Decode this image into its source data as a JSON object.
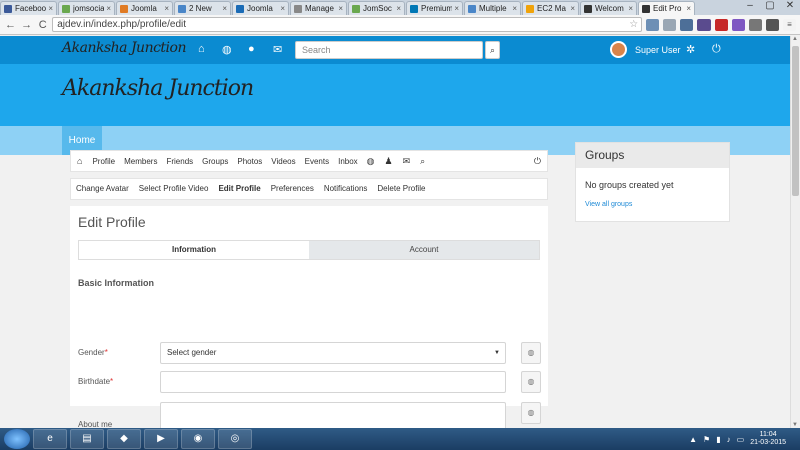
{
  "browser": {
    "tabs": [
      {
        "label": "Facebook",
        "color": "#3b5998",
        "active": false
      },
      {
        "label": "jomsocial",
        "color": "#6aa84f",
        "active": false
      },
      {
        "label": "Joomla",
        "color": "#e07b24",
        "active": false
      },
      {
        "label": "2 New",
        "color": "#4a86c8",
        "active": false
      },
      {
        "label": "Joomla",
        "color": "#1a6bb6",
        "active": false
      },
      {
        "label": "Manage",
        "color": "#888888",
        "active": false
      },
      {
        "label": "JomSoc",
        "color": "#6aa84f",
        "active": false
      },
      {
        "label": "Premium",
        "color": "#0077b5",
        "active": false
      },
      {
        "label": "Multiple",
        "color": "#4a86c8",
        "active": false
      },
      {
        "label": "EC2 Ma",
        "color": "#f0a30a",
        "active": false
      },
      {
        "label": "Welcom",
        "color": "#333333",
        "active": false
      },
      {
        "label": "Edit Pro",
        "color": "#333333",
        "active": true
      }
    ],
    "tab_close": "×",
    "url": "ajdev.in/index.php/profile/edit",
    "back": "←",
    "forward": "→",
    "reload": "C",
    "star": "☆"
  },
  "site": {
    "logo_text": "Akanksha Junction",
    "search_placeholder": "Search",
    "search_icon": "magnifier-icon",
    "user_name": "Super User",
    "home_label": "Home"
  },
  "profile_nav": {
    "items": [
      "Profile",
      "Members",
      "Friends",
      "Groups",
      "Photos",
      "Videos",
      "Events",
      "Inbox"
    ]
  },
  "profile_subnav": {
    "items": [
      "Change Avatar",
      "Select Profile Video",
      "Edit Profile",
      "Preferences",
      "Notifications",
      "Delete Profile"
    ],
    "active": "Edit Profile"
  },
  "edit_profile": {
    "title": "Edit Profile",
    "tab_information": "Information",
    "tab_account": "Account",
    "section_basic": "Basic Information",
    "gender_label": "Gender",
    "gender_value": "Select gender",
    "birthdate_label": "Birthdate",
    "about_label": "About me",
    "required_mark": "*"
  },
  "groups": {
    "title": "Groups",
    "empty_text": "No groups created yet",
    "view_all": "View all groups"
  },
  "taskbar": {
    "time": "11:04",
    "date": "21-03-2015"
  },
  "colors": {
    "topnav": "#0b8bd1",
    "header": "#1ea7ec",
    "menu": "#8ed1f5",
    "home_active": "#57b9ec",
    "link": "#1e8ad6"
  }
}
